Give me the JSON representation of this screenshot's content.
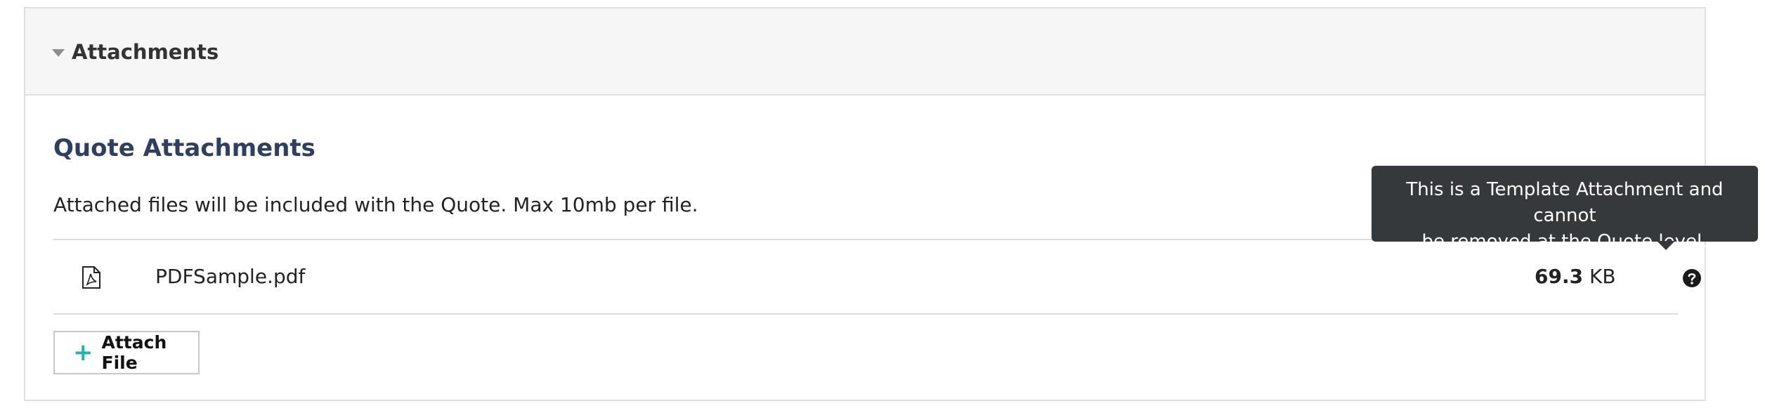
{
  "panel": {
    "header_title": "Attachments"
  },
  "section": {
    "title": "Quote Attachments",
    "description": "Attached files will be included with the Quote. Max 10mb per file."
  },
  "files": [
    {
      "name": "PDFSample.pdf",
      "icon": "pdf-file-icon",
      "size_value": "69.3",
      "size_unit": "KB",
      "action_icon": "question-circle-icon"
    }
  ],
  "attach_button": {
    "label": "Attach File",
    "icon": "plus-icon",
    "icon_glyph": "+"
  },
  "tooltip": {
    "text_line1": "This is a Template Attachment and cannot",
    "text_line2": "be removed at the Quote level."
  },
  "colors": {
    "section_title": "#2e3f62",
    "accent_plus": "#1fb3b0",
    "tooltip_bg": "#36393c",
    "header_bg": "#f6f6f6"
  }
}
